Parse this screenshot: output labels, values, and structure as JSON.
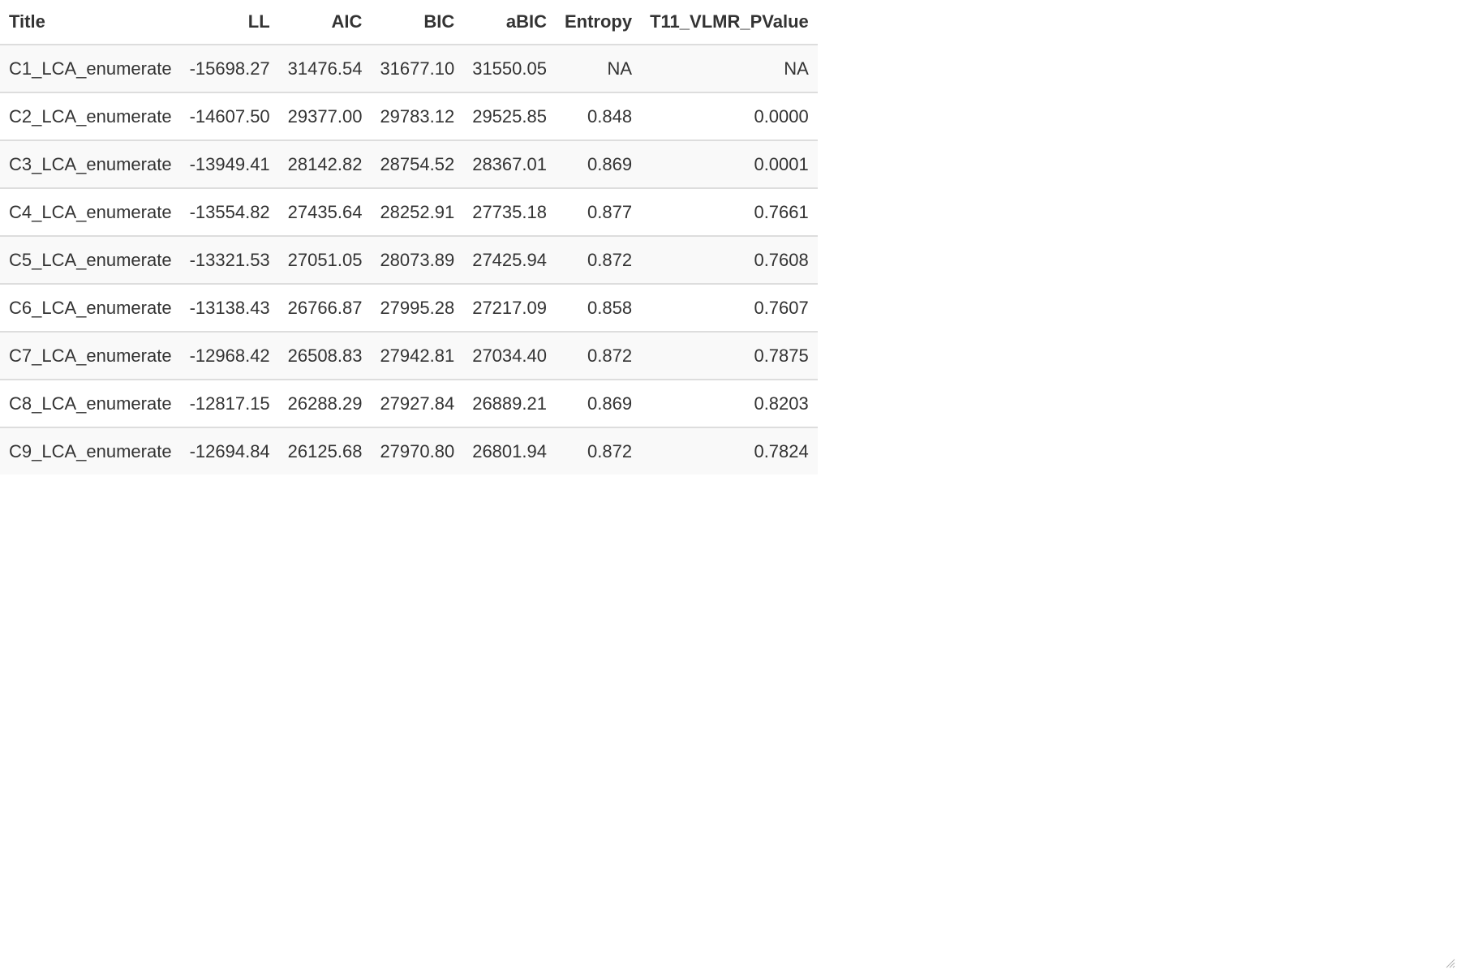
{
  "table": {
    "columns": [
      "Title",
      "LL",
      "AIC",
      "BIC",
      "aBIC",
      "Entropy",
      "T11_VLMR_PValue"
    ],
    "rows": [
      [
        "C1_LCA_enumerate",
        "-15698.27",
        "31476.54",
        "31677.10",
        "31550.05",
        "NA",
        "NA"
      ],
      [
        "C2_LCA_enumerate",
        "-14607.50",
        "29377.00",
        "29783.12",
        "29525.85",
        "0.848",
        "0.0000"
      ],
      [
        "C3_LCA_enumerate",
        "-13949.41",
        "28142.82",
        "28754.52",
        "28367.01",
        "0.869",
        "0.0001"
      ],
      [
        "C4_LCA_enumerate",
        "-13554.82",
        "27435.64",
        "28252.91",
        "27735.18",
        "0.877",
        "0.7661"
      ],
      [
        "C5_LCA_enumerate",
        "-13321.53",
        "27051.05",
        "28073.89",
        "27425.94",
        "0.872",
        "0.7608"
      ],
      [
        "C6_LCA_enumerate",
        "-13138.43",
        "26766.87",
        "27995.28",
        "27217.09",
        "0.858",
        "0.7607"
      ],
      [
        "C7_LCA_enumerate",
        "-12968.42",
        "26508.83",
        "27942.81",
        "27034.40",
        "0.872",
        "0.7875"
      ],
      [
        "C8_LCA_enumerate",
        "-12817.15",
        "26288.29",
        "27927.84",
        "26889.21",
        "0.869",
        "0.8203"
      ],
      [
        "C9_LCA_enumerate",
        "-12694.84",
        "26125.68",
        "27970.80",
        "26801.94",
        "0.872",
        "0.7824"
      ]
    ]
  },
  "icons": {
    "resize_handle": "resize-grip-icon"
  }
}
